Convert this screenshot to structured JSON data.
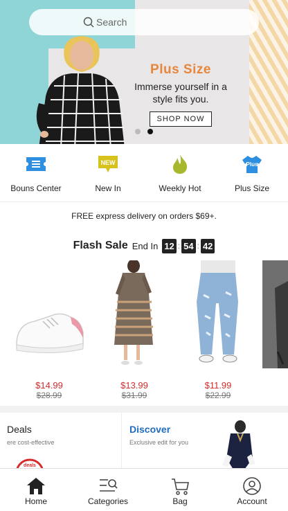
{
  "search": {
    "placeholder": "Search"
  },
  "banner": {
    "title": "Plus Size",
    "subtitle": "Immerse yourself in a style fits you.",
    "button": "SHOP NOW",
    "slides": 2,
    "active_slide": 2
  },
  "categories": [
    {
      "label": "Bouns Center",
      "icon": "ticket-icon",
      "color": "#2e8fe0"
    },
    {
      "label": "New In",
      "icon": "new-badge-icon",
      "badge_text": "NEW",
      "color": "#d7c21c"
    },
    {
      "label": "Weekly Hot",
      "icon": "flame-icon",
      "color": "#a7b82d"
    },
    {
      "label": "Plus Size",
      "icon": "tshirt-icon",
      "badge_text": "Plus",
      "color": "#2e8fe0"
    }
  ],
  "delivery_notice": "FREE express delivery on orders $69+.",
  "flash_sale": {
    "title": "Flash Sale",
    "end_label": "End In",
    "timer": [
      "12",
      "54",
      "42"
    ],
    "products": [
      {
        "image": "sneaker",
        "price": "$14.99",
        "original_price": "$28.99"
      },
      {
        "image": "patterned-dress",
        "price": "$13.99",
        "original_price": "$31.99"
      },
      {
        "image": "ripped-jeans",
        "price": "$11.99",
        "original_price": "$22.99"
      },
      {
        "image": "partial-item",
        "price": "",
        "original_price": ""
      }
    ]
  },
  "cards": {
    "deals": {
      "title": "Deals",
      "subtitle": "ere cost-effective",
      "logo_text": "deals"
    },
    "discover": {
      "title": "Discover",
      "subtitle": "Exclusive edit for you"
    }
  },
  "nav": [
    {
      "label": "Home",
      "icon": "home-icon",
      "active": true
    },
    {
      "label": "Categories",
      "icon": "categories-icon",
      "active": false
    },
    {
      "label": "Bag",
      "icon": "bag-icon",
      "active": false
    },
    {
      "label": "Account",
      "icon": "account-icon",
      "active": false
    }
  ],
  "colors": {
    "accent_orange": "#e6873c",
    "price_red": "#d62b2b",
    "link_blue": "#1f6bbf"
  }
}
